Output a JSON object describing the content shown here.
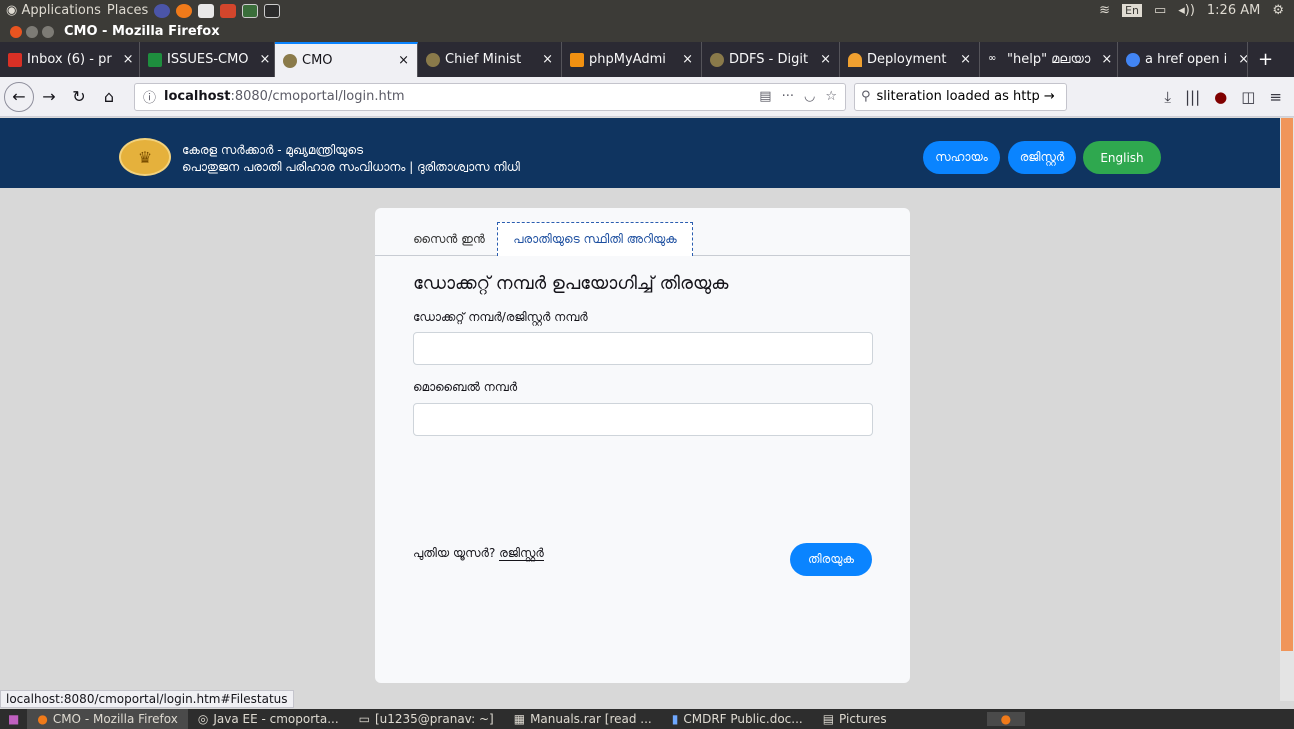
{
  "os_panel": {
    "applications": "Applications",
    "places": "Places",
    "keyboard": "En",
    "time": "1:26 AM"
  },
  "window": {
    "title": "CMO - Mozilla Firefox"
  },
  "tabs": [
    {
      "label": "Inbox (6) - pr",
      "icon": "gmail-icon",
      "color": "#d93025"
    },
    {
      "label": "ISSUES-CMO",
      "icon": "sheets-icon",
      "color": "#1e8e3e"
    },
    {
      "label": "CMO",
      "icon": "emblem-icon",
      "color": "#8a7a4a",
      "active": true
    },
    {
      "label": "Chief Minist",
      "icon": "emblem-icon",
      "color": "#8a7a4a"
    },
    {
      "label": "phpMyAdmi",
      "icon": "phpmyadmin-icon",
      "color": "#f29111"
    },
    {
      "label": "DDFS - Digit",
      "icon": "emblem-icon",
      "color": "#8a7a4a"
    },
    {
      "label": "Deployment",
      "icon": "deploy-icon",
      "color": "#f0a030"
    },
    {
      "label": "\"help\" മലയാ",
      "icon": "glasses-icon",
      "color": "#ffffff"
    },
    {
      "label": "a href open i",
      "icon": "google-icon",
      "color": "#4285f4"
    }
  ],
  "navbar": {
    "url_host": "localhost",
    "url_rest": ":8080/cmoportal/login.htm",
    "search_text": "sliteration loaded as http →"
  },
  "header": {
    "brand_line1": "കേരള സർക്കാർ - മുഖ്യമന്ത്രിയുടെ",
    "brand_line2": "പൊതുജന പരാതി പരിഹാര സംവിധാനം | ദുരിതാശ്വാസ നിധി",
    "help_label": "സഹായം",
    "register_label": "രജിസ്റ്റർ",
    "english_label": "English"
  },
  "card": {
    "tab_signin": "സൈൻ ഇൻ",
    "tab_status": "പരാതിയുടെ സ്ഥിതി അറിയുക",
    "heading": "ഡോക്കറ്റ് നമ്പർ ഉപയോഗിച്ച് തിരയുക",
    "docket_label": "ഡോക്കറ്റ് നമ്പർ/രജിസ്റ്റർ നമ്പർ",
    "docket_value": "",
    "mobile_label": "മൊബൈൽ നമ്പർ",
    "mobile_value": "",
    "new_user_text": "പുതിയ യൂസർ?",
    "register_link": "രജിസ്റ്റർ",
    "search_button": "തിരയുക"
  },
  "statusbar": {
    "text": "localhost:8080/cmoportal/login.htm#Filestatus"
  },
  "taskbar": [
    {
      "label": "CMO - Mozilla Firefox",
      "icon": "firefox-icon",
      "active": true
    },
    {
      "label": "Java EE - cmoporta...",
      "icon": "eclipse-icon"
    },
    {
      "label": "[u1235@pranav: ~]",
      "icon": "terminal-icon"
    },
    {
      "label": "Manuals.rar [read ...",
      "icon": "archive-icon"
    },
    {
      "label": "CMDRF Public.doc...",
      "icon": "document-icon"
    },
    {
      "label": "Pictures",
      "icon": "folder-icon"
    }
  ]
}
